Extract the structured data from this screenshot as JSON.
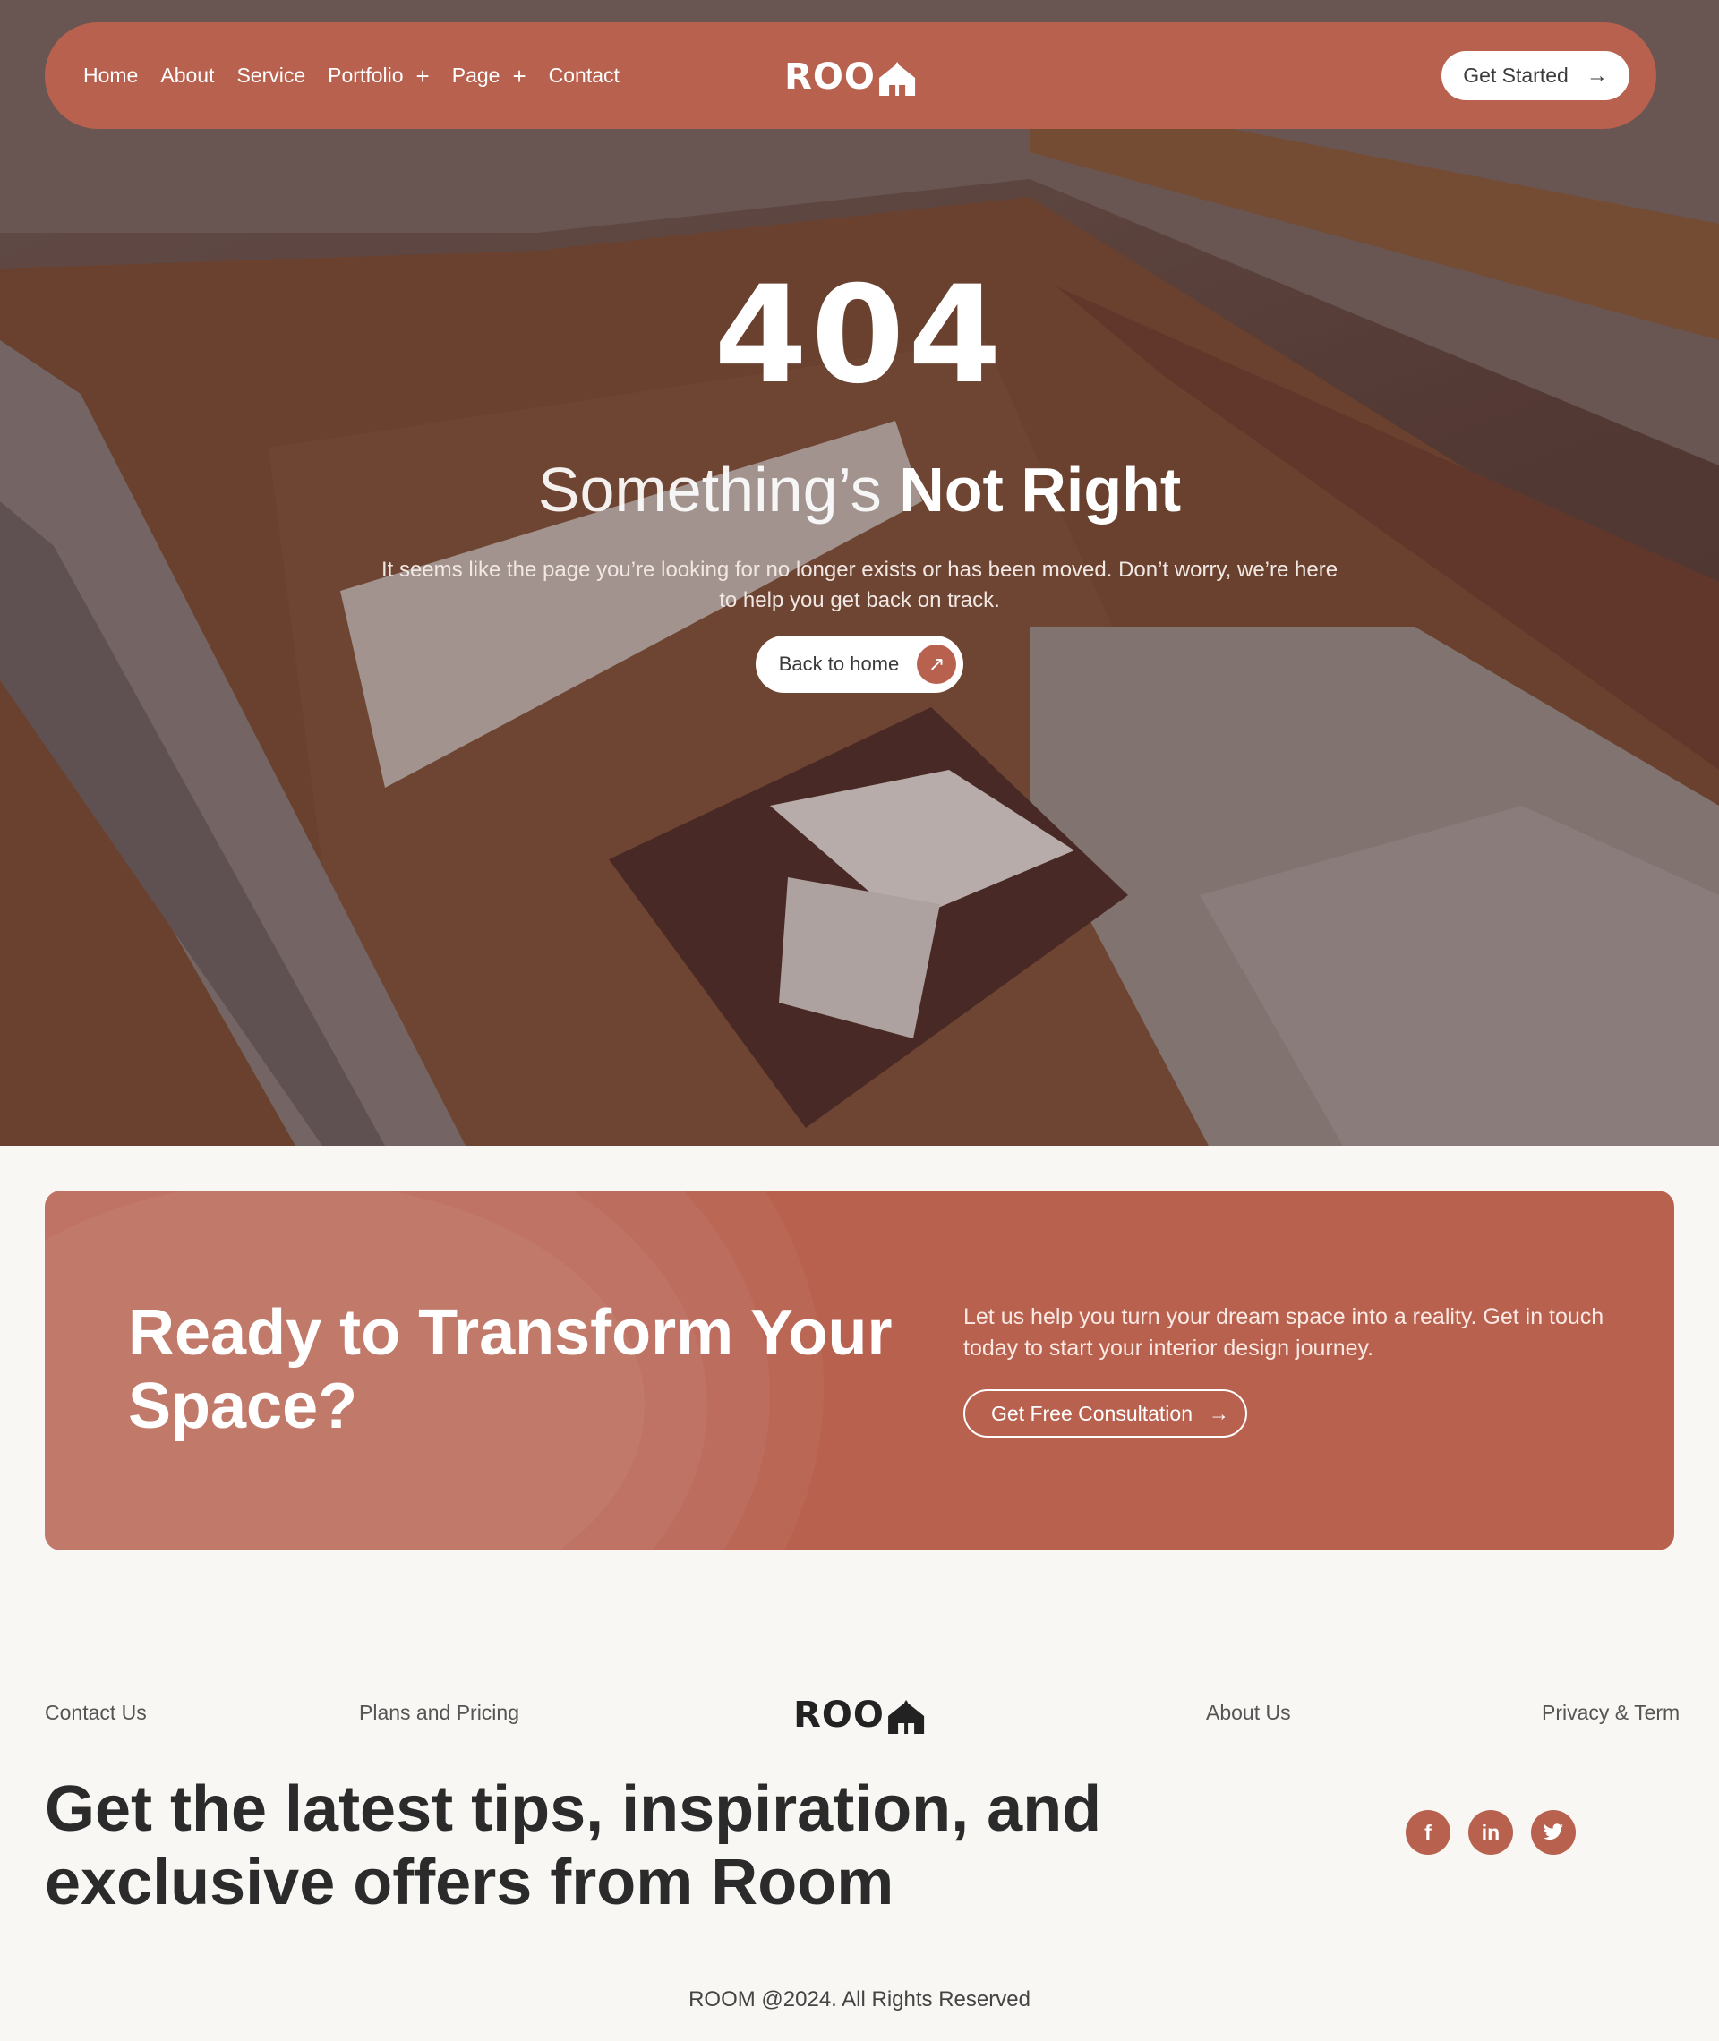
{
  "nav": {
    "items": [
      {
        "label": "Home",
        "has_submenu": false
      },
      {
        "label": "About",
        "has_submenu": false
      },
      {
        "label": "Service",
        "has_submenu": false
      },
      {
        "label": "Portfolio",
        "has_submenu": true
      },
      {
        "label": "Page",
        "has_submenu": true
      },
      {
        "label": "Contact",
        "has_submenu": false
      }
    ],
    "submenu_glyph": "+",
    "logo_text": "ROO",
    "cta_label": "Get Started",
    "cta_icon": "arrow-right-icon"
  },
  "hero": {
    "code": "404",
    "title_part1": "Something’s",
    "title_part2": "Not Right",
    "text": "It seems like the page you’re looking for no longer exists or has been moved. Don’t worry, we’re here to help you get back on track.",
    "button_label": "Back to home",
    "button_icon": "arrow-up-right-icon"
  },
  "cta": {
    "title": "Ready to Transform Your Space?",
    "text": "Let us help you turn your dream space into a reality. Get in touch today to start your interior design journey.",
    "button_label": "Get Free Consultation",
    "button_icon": "arrow-right-icon"
  },
  "footer": {
    "links": {
      "contact": "Contact Us",
      "plans": "Plans and Pricing",
      "about": "About Us",
      "privacy": "Privacy & Term"
    },
    "logo_text": "ROO",
    "newsletter": "Get the latest tips, inspiration, and exclusive offers from Room",
    "socials": [
      {
        "name": "facebook-icon",
        "glyph": "f"
      },
      {
        "name": "linkedin-icon",
        "glyph": "in"
      },
      {
        "name": "twitter-icon",
        "glyph": "🐦"
      }
    ],
    "copyright": "ROOM @2024. All Rights Reserved"
  },
  "colors": {
    "accent": "#b8614f",
    "page_bg": "#f8f7f3",
    "text_dark": "#2b2b2b"
  }
}
